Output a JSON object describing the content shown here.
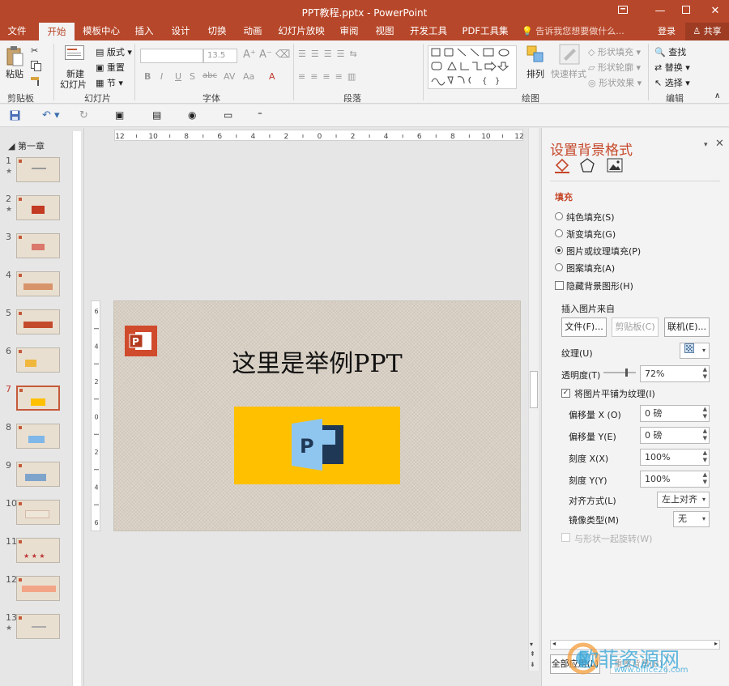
{
  "window": {
    "title": "PPT教程.pptx - PowerPoint"
  },
  "tabs": [
    "文件",
    "开始",
    "模板中心",
    "插入",
    "设计",
    "切换",
    "动画",
    "幻灯片放映",
    "审阅",
    "视图",
    "开发工具",
    "PDF工具集"
  ],
  "tell_me": "告诉我您想要做什么...",
  "login": "登录",
  "share": "共享",
  "ribbon": {
    "clipboard": {
      "paste": "粘贴",
      "group": "剪贴板"
    },
    "slides": {
      "new_slide_line1": "新建",
      "new_slide_line2": "幻灯片",
      "layout": "版式",
      "reset": "重置",
      "section": "节",
      "group": "幻灯片"
    },
    "font": {
      "font_name": "",
      "font_size": "13.5",
      "group": "字体"
    },
    "paragraph": {
      "group": "段落"
    },
    "drawing": {
      "arrange": "排列",
      "quick_styles": "快速样式",
      "shape_fill": "形状填充",
      "shape_outline": "形状轮廓",
      "shape_effects": "形状效果",
      "group": "绘图"
    },
    "editing": {
      "find": "查找",
      "replace": "替换",
      "select": "选择",
      "group": "编辑"
    }
  },
  "slides_pane": {
    "section_name": "第一章",
    "slides": [
      {
        "num": "1",
        "star": true
      },
      {
        "num": "2",
        "star": true
      },
      {
        "num": "3",
        "star": false
      },
      {
        "num": "4",
        "star": false
      },
      {
        "num": "5",
        "star": false
      },
      {
        "num": "6",
        "star": false
      },
      {
        "num": "7",
        "star": false,
        "selected": true
      },
      {
        "num": "8",
        "star": false
      },
      {
        "num": "9",
        "star": false
      },
      {
        "num": "10",
        "star": false
      },
      {
        "num": "11",
        "star": false
      },
      {
        "num": "12",
        "star": false
      },
      {
        "num": "13",
        "star": true
      }
    ]
  },
  "slide": {
    "title": "这里是举例PPT"
  },
  "format_pane": {
    "title": "设置背景格式",
    "fill_section": "填充",
    "options": {
      "solid": "纯色填充(S)",
      "gradient": "渐变填充(G)",
      "picture": "图片或纹理填充(P)",
      "pattern": "图案填充(A)",
      "hide_bg": "隐藏背景图形(H)"
    },
    "insert_from": "插入图片来自",
    "file_btn": "文件(F)...",
    "clipboard_btn": "剪贴板(C)",
    "online_btn": "联机(E)...",
    "texture_label": "纹理(U)",
    "transparency_label": "透明度(T)",
    "transparency_value": "72%",
    "tile_label": "将图片平铺为纹理(I)",
    "offset_x_label": "偏移量 X (O)",
    "offset_x_value": "0 磅",
    "offset_y_label": "偏移量 Y(E)",
    "offset_y_value": "0 磅",
    "scale_x_label": "刻度 X(X)",
    "scale_x_value": "100%",
    "scale_y_label": "刻度 Y(Y)",
    "scale_y_value": "100%",
    "align_label": "对齐方式(L)",
    "align_value": "左上对齐",
    "mirror_label": "镜像类型(M)",
    "mirror_value": "无",
    "rotate_label": "与形状一起旋转(W)",
    "apply_all": "全部应用(L)",
    "reset_bg": "重置背景(B)"
  },
  "watermark": {
    "text": "欧菲资源网",
    "url": "www.office26.com"
  },
  "colors": {
    "accent": "#b7472a",
    "pane_title": "#c5472a",
    "yellow": "#ffc000",
    "ppt_blue": "#7fb7e8"
  }
}
